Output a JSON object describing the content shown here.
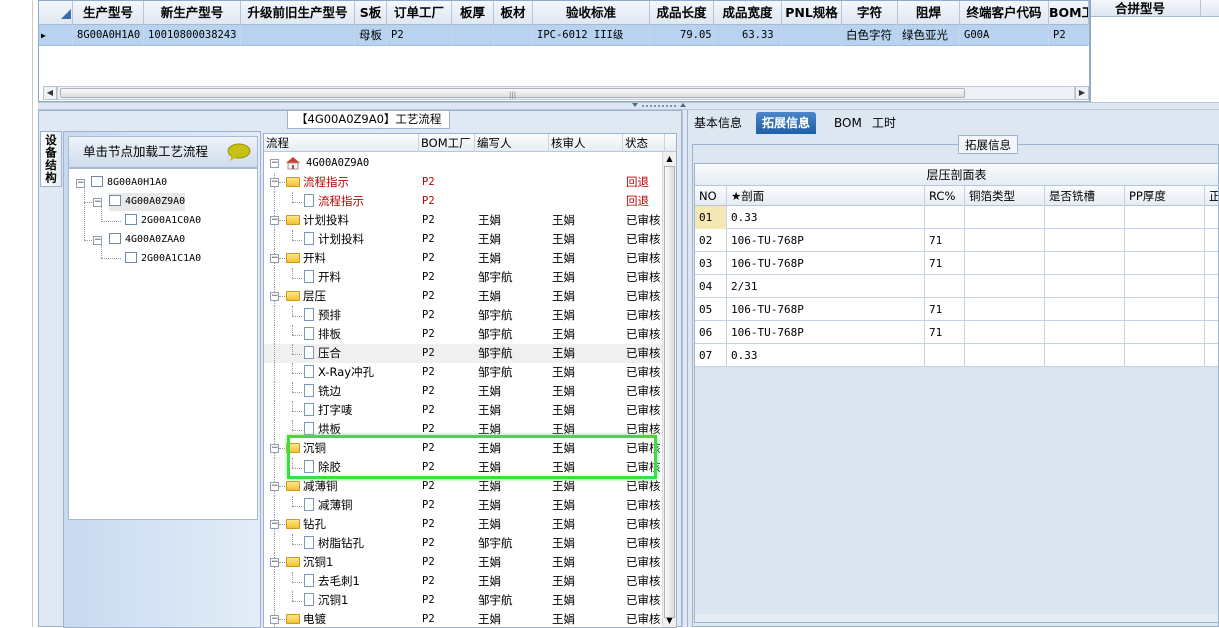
{
  "top_grid": {
    "columns": [
      "生产型号",
      "新生产型号",
      "升级前旧生产型号",
      "S板",
      "订单工厂",
      "板厚",
      "板材",
      "验收标准",
      "成品长度",
      "成品宽度",
      "PNL规格",
      "字符",
      "阻焊",
      "终端客户代码",
      "BOM工"
    ],
    "row": [
      "8G00A0H1A0",
      "10010800038243",
      "",
      "母板",
      "P2",
      "",
      "",
      "IPC-6012 III级",
      "79.05",
      "63.33",
      "",
      "白色字符",
      "绿色亚光",
      "G00A",
      "P2"
    ],
    "merge_header": "合拼型号"
  },
  "process_panel": {
    "title": "【4G00A0Z9A0】工艺流程",
    "vertical_tab": "设备结构",
    "struct_header": "单击节点加载工艺流程",
    "struct_nodes": [
      "8G00A0H1A0",
      "4G00A0Z9A0",
      "2G00A1C0A0",
      "4G00A0ZAA0",
      "2G00A1C1A0"
    ]
  },
  "process_tree": {
    "columns": [
      "流程",
      "BOM工厂",
      "编写人",
      "核审人",
      "状态"
    ],
    "root": "4G00A0Z9A0",
    "rows": [
      {
        "name": "流程指示",
        "type": "folder",
        "bom": "P2",
        "writer": "",
        "reviewer": "",
        "status": "回退",
        "red": true
      },
      {
        "name": "流程指示",
        "type": "doc",
        "bom": "P2",
        "writer": "",
        "reviewer": "",
        "status": "回退",
        "red": true
      },
      {
        "name": "计划投料",
        "type": "folder",
        "bom": "P2",
        "writer": "王娟",
        "reviewer": "王娟",
        "status": "已审核"
      },
      {
        "name": "计划投料",
        "type": "doc",
        "bom": "P2",
        "writer": "王娟",
        "reviewer": "王娟",
        "status": "已审核"
      },
      {
        "name": "开料",
        "type": "folder",
        "bom": "P2",
        "writer": "王娟",
        "reviewer": "王娟",
        "status": "已审核"
      },
      {
        "name": "开料",
        "type": "doc",
        "bom": "P2",
        "writer": "邹宇航",
        "reviewer": "王娟",
        "status": "已审核"
      },
      {
        "name": "层压",
        "type": "folder",
        "bom": "P2",
        "writer": "王娟",
        "reviewer": "王娟",
        "status": "已审核"
      },
      {
        "name": "预排",
        "type": "doc",
        "bom": "P2",
        "writer": "邹宇航",
        "reviewer": "王娟",
        "status": "已审核"
      },
      {
        "name": "排板",
        "type": "doc",
        "bom": "P2",
        "writer": "邹宇航",
        "reviewer": "王娟",
        "status": "已审核"
      },
      {
        "name": "压合",
        "type": "doc",
        "bom": "P2",
        "writer": "邹宇航",
        "reviewer": "王娟",
        "status": "已审核",
        "selected": true
      },
      {
        "name": "X-Ray冲孔",
        "type": "doc",
        "bom": "P2",
        "writer": "邹宇航",
        "reviewer": "王娟",
        "status": "已审核"
      },
      {
        "name": "铣边",
        "type": "doc",
        "bom": "P2",
        "writer": "王娟",
        "reviewer": "王娟",
        "status": "已审核"
      },
      {
        "name": "打字唛",
        "type": "doc",
        "bom": "P2",
        "writer": "王娟",
        "reviewer": "王娟",
        "status": "已审核"
      },
      {
        "name": "烘板",
        "type": "doc",
        "bom": "P2",
        "writer": "王娟",
        "reviewer": "王娟",
        "status": "已审核"
      },
      {
        "name": "沉铜",
        "type": "folder",
        "bom": "P2",
        "writer": "王娟",
        "reviewer": "王娟",
        "status": "已审核"
      },
      {
        "name": "除胶",
        "type": "doc",
        "bom": "P2",
        "writer": "王娟",
        "reviewer": "王娟",
        "status": "已审核"
      },
      {
        "name": "减薄铜",
        "type": "folder",
        "bom": "P2",
        "writer": "王娟",
        "reviewer": "王娟",
        "status": "已审核"
      },
      {
        "name": "减薄铜",
        "type": "doc",
        "bom": "P2",
        "writer": "王娟",
        "reviewer": "王娟",
        "status": "已审核"
      },
      {
        "name": "钻孔",
        "type": "folder",
        "bom": "P2",
        "writer": "王娟",
        "reviewer": "王娟",
        "status": "已审核"
      },
      {
        "name": "树脂钻孔",
        "type": "doc",
        "bom": "P2",
        "writer": "邹宇航",
        "reviewer": "王娟",
        "status": "已审核"
      },
      {
        "name": "沉铜1",
        "type": "folder",
        "bom": "P2",
        "writer": "王娟",
        "reviewer": "王娟",
        "status": "已审核"
      },
      {
        "name": "去毛刺1",
        "type": "doc",
        "bom": "P2",
        "writer": "王娟",
        "reviewer": "王娟",
        "status": "已审核"
      },
      {
        "name": "沉铜1",
        "type": "doc",
        "bom": "P2",
        "writer": "邹宇航",
        "reviewer": "王娟",
        "status": "已审核"
      },
      {
        "name": "电镀",
        "type": "folder",
        "bom": "P2",
        "writer": "王娟",
        "reviewer": "王娟",
        "status": "已审核"
      }
    ]
  },
  "right_panel": {
    "tabs": [
      "基本信息",
      "拓展信息",
      "BOM",
      "工时"
    ],
    "active_tab": 1,
    "ext_legend": "拓展信息",
    "table_caption": "层压剖面表",
    "columns": [
      "NO",
      "★剖面",
      "RC%",
      "铜箔类型",
      "是否铣槽",
      "PP厚度",
      "正"
    ],
    "rows": [
      [
        "01",
        "0.33",
        "",
        "",
        "",
        "",
        ""
      ],
      [
        "02",
        "106-TU-768P",
        "71",
        "",
        "",
        "",
        ""
      ],
      [
        "03",
        "106-TU-768P",
        "71",
        "",
        "",
        "",
        ""
      ],
      [
        "04",
        "2/31",
        "",
        "",
        "",
        "",
        ""
      ],
      [
        "05",
        "106-TU-768P",
        "71",
        "",
        "",
        "",
        ""
      ],
      [
        "06",
        "106-TU-768P",
        "71",
        "",
        "",
        "",
        ""
      ],
      [
        "07",
        "0.33",
        "",
        "",
        "",
        "",
        ""
      ]
    ]
  },
  "colors": {
    "selection": "#b8d3ef",
    "highlight": "#3fdc3f",
    "active_tab": "#2b6cb3",
    "red_text": "#c00000"
  }
}
